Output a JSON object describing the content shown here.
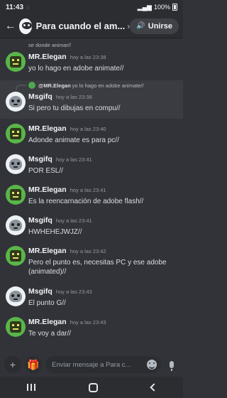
{
  "status_bar": {
    "time": "11:43",
    "left_icons": "◌",
    "battery": "100%"
  },
  "header": {
    "back_icon": "arrow-left-icon",
    "title": "Para cuando el am...",
    "chevron": "›",
    "join_label": "Unirse"
  },
  "messages": {
    "top_cut_text": "se donde animar//",
    "items": [
      {
        "author": "MR.Elegan",
        "time": "hoy a las 23:38",
        "text": "yo lo hago en adobe animate//",
        "avatar": "green"
      },
      {
        "author": "Msgifq",
        "time": "hoy a las 23:38",
        "text": "Si pero tu dibujas en compu//",
        "avatar": "white",
        "reply_to_author": "@MR.Elegan",
        "reply_to_text": "yo lo hago en adobe animate//"
      },
      {
        "author": "MR.Elegan",
        "time": "hoy a las 23:40",
        "text": "Adonde animate es para pc//",
        "avatar": "green"
      },
      {
        "author": "Msgifq",
        "time": "hoy a las 23:41",
        "text": "POR ESL//",
        "avatar": "white"
      },
      {
        "author": "MR.Elegan",
        "time": "hoy a las 23:41",
        "text": "Es la reencarnación de adobe flash//",
        "avatar": "green"
      },
      {
        "author": "Msgifq",
        "time": "hoy a las 23:41",
        "text": "HWHEHEJWJZ//",
        "avatar": "white"
      },
      {
        "author": "MR.Elegan",
        "time": "hoy a las 23:42",
        "text": "Pero el punto es, necesitas PC y ese adobe (animated)//",
        "avatar": "green"
      },
      {
        "author": "Msgifq",
        "time": "hoy a las 23:43",
        "text": "El punto G//",
        "avatar": "white"
      },
      {
        "author": "MR.Elegan",
        "time": "hoy a las 23:43",
        "text": "Te voy a dar//",
        "avatar": "green"
      }
    ]
  },
  "composer": {
    "plus_icon": "+",
    "gift_icon": "gift-icon",
    "placeholder": "Enviar mensaje a Para c...",
    "emoji_icon": "smile-icon",
    "mic_icon": "mic-icon"
  }
}
